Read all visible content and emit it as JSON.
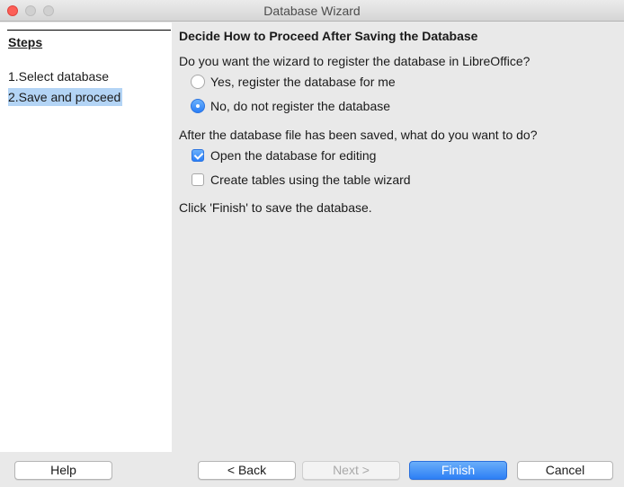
{
  "window": {
    "title": "Database Wizard"
  },
  "sidebar": {
    "title": "Steps",
    "steps": [
      {
        "label": "1.Select database",
        "active": false
      },
      {
        "label": "2.Save and proceed",
        "active": true
      }
    ]
  },
  "main": {
    "heading": "Decide How to Proceed After Saving the Database",
    "register_question": "Do you want the wizard to register the database in LibreOffice?",
    "register_options": [
      {
        "label": "Yes, register the database for me",
        "selected": false
      },
      {
        "label": "No, do not register the database",
        "selected": true
      }
    ],
    "after_save_question": "After the database file has been saved, what do you want to do?",
    "after_save_options": [
      {
        "label": "Open the database for editing",
        "checked": true
      },
      {
        "label": "Create tables using the table wizard",
        "checked": false
      }
    ],
    "finish_note": "Click 'Finish' to save the database."
  },
  "footer": {
    "help_label": "Help",
    "back_label": "< Back",
    "next_label": "Next >",
    "finish_label": "Finish",
    "cancel_label": "Cancel"
  },
  "colors": {
    "accent": "#2d7ff5",
    "selection": "#b3d4f5",
    "close_button": "#fc5f57"
  }
}
